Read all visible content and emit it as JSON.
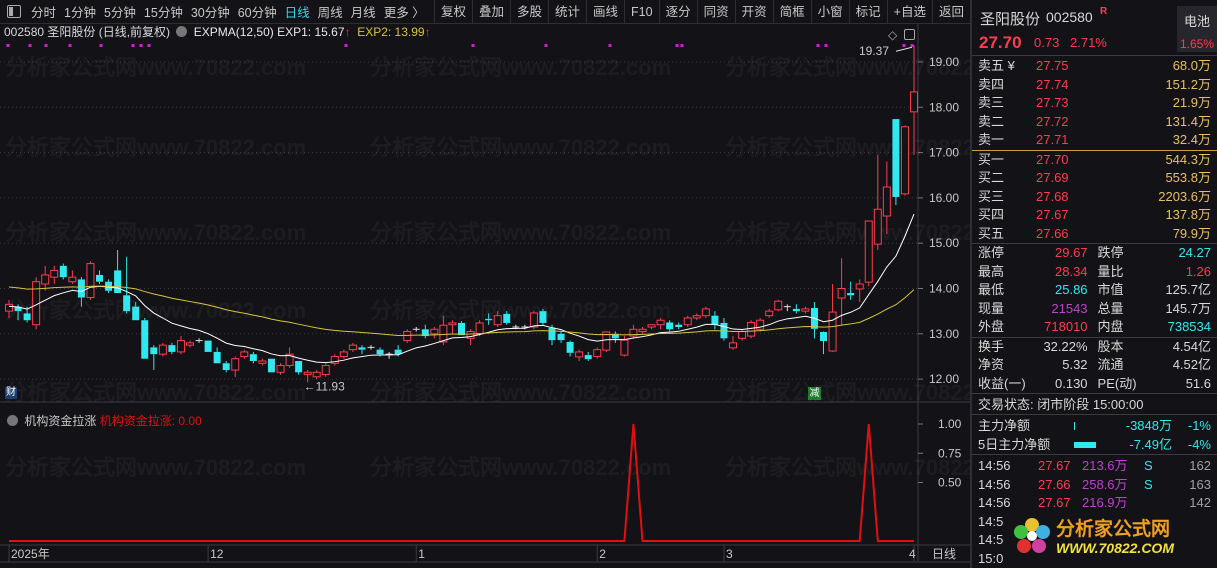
{
  "toolbar": {
    "periods": [
      "分时",
      "1分钟",
      "5分钟",
      "15分钟",
      "30分钟",
      "60分钟",
      "日线",
      "周线",
      "月线",
      "更多 〉"
    ],
    "active_period": "日线",
    "buttons": [
      "复权",
      "叠加",
      "多股",
      "统计",
      "画线",
      "F10",
      "逐分",
      "同资",
      "开资",
      "简框",
      "小窗",
      "标记",
      "+自选",
      "返回"
    ]
  },
  "info": {
    "title": "002580 圣阳股份 (日线,前复权)",
    "indicator": "EXPMA(12,50)",
    "exp1": "EXP1: 15.67",
    "exp2": "EXP2: 13.99",
    "arrow": "↑"
  },
  "sub_panel": {
    "name": "机构资金拉涨",
    "value_label": "机构资金拉涨: 0.00"
  },
  "badges": {
    "cai": "财",
    "jian": "减"
  },
  "colors": {
    "up": "#ff3b50",
    "down": "#30e8f0",
    "exp1": "#ffffff",
    "exp2": "#d8c43a",
    "spike": "#e01010"
  },
  "chart_data": {
    "type": "candlestick",
    "title": "002580 圣阳股份 (日线,前复权)",
    "ylim": [
      11.7,
      19.5
    ],
    "yticks": [
      "19.00",
      "18.00",
      "17.00",
      "16.00",
      "15.00",
      "14.00",
      "13.00",
      "12.00"
    ],
    "xticks": [
      {
        "label": "2025年",
        "index": 0
      },
      {
        "label": "12",
        "index": 22
      },
      {
        "label": "1",
        "index": 45
      },
      {
        "label": "2",
        "index": 65
      },
      {
        "label": "3",
        "index": 79
      },
      {
        "label": "4",
        "index": 100
      }
    ],
    "x_period_label": "日线",
    "annotations": {
      "high": "19.37",
      "low": "11.93"
    },
    "exp1_seed": 13.6,
    "exp2_seed": 14.05,
    "ohlc": [
      [
        13.5,
        13.75,
        13.35,
        13.65
      ],
      [
        13.6,
        13.65,
        13.3,
        13.5
      ],
      [
        13.45,
        13.6,
        13.25,
        13.3
      ],
      [
        13.2,
        14.25,
        13.1,
        14.15
      ],
      [
        14.1,
        14.5,
        13.95,
        14.3
      ],
      [
        14.25,
        14.5,
        14.1,
        14.4
      ],
      [
        14.5,
        14.55,
        14.2,
        14.25
      ],
      [
        14.15,
        14.4,
        14.1,
        14.25
      ],
      [
        14.2,
        14.25,
        13.6,
        13.8
      ],
      [
        13.8,
        14.6,
        13.75,
        14.55
      ],
      [
        14.3,
        14.4,
        14.1,
        14.15
      ],
      [
        14.15,
        14.2,
        13.9,
        13.95
      ],
      [
        14.4,
        14.85,
        13.9,
        13.9
      ],
      [
        13.85,
        14.7,
        13.45,
        13.5
      ],
      [
        13.6,
        13.7,
        13.3,
        13.3
      ],
      [
        13.3,
        13.35,
        12.45,
        12.45
      ],
      [
        12.7,
        12.75,
        12.2,
        12.55
      ],
      [
        12.55,
        12.8,
        12.5,
        12.75
      ],
      [
        12.75,
        12.8,
        12.55,
        12.6
      ],
      [
        12.6,
        12.95,
        12.55,
        12.85
      ],
      [
        12.75,
        12.85,
        12.7,
        12.8
      ],
      [
        12.85,
        12.9,
        12.8,
        12.85
      ],
      [
        12.85,
        12.85,
        12.6,
        12.6
      ],
      [
        12.6,
        12.7,
        12.35,
        12.35
      ],
      [
        12.35,
        12.4,
        12.15,
        12.2
      ],
      [
        12.2,
        12.5,
        12.05,
        12.45
      ],
      [
        12.5,
        12.65,
        12.45,
        12.6
      ],
      [
        12.55,
        12.6,
        12.35,
        12.4
      ],
      [
        12.35,
        12.45,
        12.3,
        12.4
      ],
      [
        12.45,
        12.45,
        12.15,
        12.15
      ],
      [
        12.15,
        12.35,
        12.1,
        12.3
      ],
      [
        12.3,
        12.7,
        12.25,
        12.55
      ],
      [
        12.4,
        12.4,
        12.1,
        12.15
      ],
      [
        12.1,
        12.2,
        11.93,
        12.15
      ],
      [
        12.05,
        12.2,
        12.0,
        12.15
      ],
      [
        12.1,
        12.35,
        12.05,
        12.3
      ],
      [
        12.35,
        12.55,
        12.3,
        12.5
      ],
      [
        12.5,
        12.65,
        12.45,
        12.6
      ],
      [
        12.65,
        12.8,
        12.6,
        12.75
      ],
      [
        12.7,
        12.75,
        12.55,
        12.65
      ],
      [
        12.7,
        12.75,
        12.65,
        12.7
      ],
      [
        12.65,
        12.7,
        12.5,
        12.55
      ],
      [
        12.55,
        12.6,
        12.45,
        12.55
      ],
      [
        12.65,
        12.75,
        12.5,
        12.55
      ],
      [
        12.85,
        13.1,
        12.8,
        13.05
      ],
      [
        13.1,
        13.15,
        13.05,
        13.1
      ],
      [
        13.1,
        13.2,
        12.9,
        12.95
      ],
      [
        13.0,
        13.15,
        12.9,
        13.1
      ],
      [
        12.82,
        13.4,
        12.75,
        13.19
      ],
      [
        13.2,
        13.3,
        13.0,
        13.24
      ],
      [
        13.24,
        13.28,
        12.97,
        12.97
      ],
      [
        12.9,
        13.1,
        12.75,
        13.05
      ],
      [
        13.0,
        13.3,
        12.95,
        13.24
      ],
      [
        13.33,
        13.45,
        13.2,
        13.3
      ],
      [
        13.2,
        13.5,
        13.15,
        13.4
      ],
      [
        13.44,
        13.5,
        13.2,
        13.24
      ],
      [
        13.15,
        13.2,
        13.1,
        13.15
      ],
      [
        13.15,
        13.2,
        13.1,
        13.15
      ],
      [
        13.15,
        13.5,
        13.1,
        13.46
      ],
      [
        13.5,
        13.55,
        13.2,
        13.24
      ],
      [
        13.13,
        13.2,
        12.75,
        12.86
      ],
      [
        13.0,
        13.05,
        12.8,
        12.86
      ],
      [
        12.82,
        12.85,
        12.5,
        12.58
      ],
      [
        12.49,
        12.65,
        12.4,
        12.6
      ],
      [
        12.53,
        12.6,
        12.4,
        12.44
      ],
      [
        12.5,
        12.7,
        12.45,
        12.65
      ],
      [
        12.64,
        13.05,
        12.6,
        13.04
      ],
      [
        13.0,
        13.05,
        12.8,
        12.9
      ],
      [
        12.53,
        12.95,
        12.5,
        12.86
      ],
      [
        12.95,
        13.2,
        12.9,
        13.1
      ],
      [
        13.05,
        13.15,
        13.0,
        13.1
      ],
      [
        13.15,
        13.2,
        13.1,
        13.2
      ],
      [
        13.2,
        13.35,
        13.1,
        13.3
      ],
      [
        13.25,
        13.3,
        13.05,
        13.1
      ],
      [
        13.2,
        13.25,
        13.1,
        13.15
      ],
      [
        13.2,
        13.4,
        13.15,
        13.35
      ],
      [
        13.35,
        13.45,
        13.3,
        13.4
      ],
      [
        13.4,
        13.6,
        13.35,
        13.55
      ],
      [
        13.4,
        13.5,
        13.1,
        13.2
      ],
      [
        13.24,
        13.35,
        12.85,
        12.9
      ],
      [
        12.69,
        12.95,
        12.65,
        12.8
      ],
      [
        12.9,
        13.1,
        12.85,
        13.05
      ],
      [
        12.95,
        13.3,
        12.9,
        13.25
      ],
      [
        13.1,
        13.35,
        13.05,
        13.3
      ],
      [
        13.4,
        13.55,
        13.35,
        13.5
      ],
      [
        13.53,
        13.75,
        13.5,
        13.72
      ],
      [
        13.6,
        13.65,
        13.5,
        13.6
      ],
      [
        13.55,
        13.65,
        13.45,
        13.5
      ],
      [
        13.5,
        13.6,
        13.45,
        13.55
      ],
      [
        13.57,
        13.7,
        12.9,
        13.11
      ],
      [
        13.04,
        13.05,
        12.55,
        12.84
      ],
      [
        12.62,
        14.1,
        12.6,
        13.48
      ],
      [
        13.79,
        14.67,
        13.2,
        14.0
      ],
      [
        13.9,
        14.15,
        13.75,
        13.85
      ],
      [
        13.99,
        14.2,
        13.7,
        14.1
      ],
      [
        14.14,
        15.5,
        14.05,
        15.49
      ],
      [
        14.98,
        16.95,
        14.85,
        15.75
      ],
      [
        15.6,
        16.8,
        15.2,
        16.24
      ],
      [
        17.74,
        17.74,
        15.84,
        16.02
      ],
      [
        16.09,
        17.6,
        16.05,
        17.57
      ],
      [
        17.9,
        19.37,
        16.95,
        18.34
      ]
    ],
    "sub_indicator": {
      "name": "机构资金拉涨",
      "yticks": [
        "1.00",
        "0.75",
        "0.50"
      ],
      "ylim": [
        0,
        1
      ],
      "spike_indices": [
        69,
        95
      ]
    }
  },
  "quote": {
    "name": "圣阳股份",
    "code": "002580",
    "r_badge": "R",
    "sector_button": "电池",
    "sector_change": "1.65%",
    "price": "27.70",
    "change": "0.73",
    "change_pct": "2.71%",
    "asks": [
      {
        "label": "卖五 ¥",
        "price": "27.75",
        "vol": "68.0万"
      },
      {
        "label": "卖四",
        "price": "27.74",
        "vol": "151.2万"
      },
      {
        "label": "卖三",
        "price": "27.73",
        "vol": "21.9万"
      },
      {
        "label": "卖二",
        "price": "27.72",
        "vol": "131.4万"
      },
      {
        "label": "卖一",
        "price": "27.71",
        "vol": "32.4万"
      }
    ],
    "bids": [
      {
        "label": "买一",
        "price": "27.70",
        "vol": "544.3万"
      },
      {
        "label": "买二",
        "price": "27.69",
        "vol": "553.8万"
      },
      {
        "label": "买三",
        "price": "27.68",
        "vol": "2203.6万"
      },
      {
        "label": "买四",
        "price": "27.67",
        "vol": "137.8万"
      },
      {
        "label": "买五",
        "price": "27.66",
        "vol": "79.9万"
      }
    ],
    "stats": [
      [
        {
          "l": "涨停",
          "v": "29.67",
          "c": "red"
        },
        {
          "l": "跌停",
          "v": "24.27",
          "c": "cy"
        }
      ],
      [
        {
          "l": "最高",
          "v": "28.34",
          "c": "red"
        },
        {
          "l": "量比",
          "v": "1.26",
          "c": "red"
        }
      ],
      [
        {
          "l": "最低",
          "v": "25.86",
          "c": "cy"
        },
        {
          "l": "市值",
          "v": "125.7亿",
          "c": "wh"
        }
      ],
      [
        {
          "l": "现量",
          "v": "21543",
          "c": "pur"
        },
        {
          "l": "总量",
          "v": "145.7万",
          "c": "wh"
        }
      ],
      [
        {
          "l": "外盘",
          "v": "718010",
          "c": "red"
        },
        {
          "l": "内盘",
          "v": "738534",
          "c": "cy"
        }
      ]
    ],
    "fundamentals": [
      [
        {
          "l": "换手",
          "v": "32.22%"
        },
        {
          "l": "股本",
          "v": "4.54亿"
        }
      ],
      [
        {
          "l": "净资",
          "v": "5.32"
        },
        {
          "l": "流通",
          "v": "4.52亿"
        }
      ],
      [
        {
          "l": "收益(一)",
          "v": "0.130"
        },
        {
          "l": "PE(动)",
          "v": "51.6"
        }
      ]
    ],
    "status": "交易状态: 闭市阶段 15:00:00",
    "main_force": [
      {
        "l": "主力净额",
        "v": "-3848万",
        "p": "-1%",
        "bar": 0.05
      },
      {
        "l": "5日主力净额",
        "v": "-7.49亿",
        "p": "-4%",
        "bar": 1
      }
    ],
    "ticks": [
      {
        "t": "14:56",
        "p": "27.67",
        "v": "213.6万",
        "s": "S",
        "n": "162"
      },
      {
        "t": "14:56",
        "p": "27.66",
        "v": "258.6万",
        "s": "S",
        "n": "163"
      },
      {
        "t": "14:56",
        "p": "27.67",
        "v": "216.9万",
        "s": "",
        "n": "142"
      },
      {
        "t": "14:5",
        "p": "",
        "v": "",
        "s": "",
        "n": ""
      },
      {
        "t": "14:5",
        "p": "",
        "v": "",
        "s": "",
        "n": ""
      },
      {
        "t": "15:0",
        "p": "",
        "v": "",
        "s": "",
        "n": ""
      }
    ]
  },
  "watermark": {
    "text": "分析家公式网www.70822.com",
    "logo_cn": "分析家公式网",
    "logo_url": "WWW.70822.COM"
  }
}
